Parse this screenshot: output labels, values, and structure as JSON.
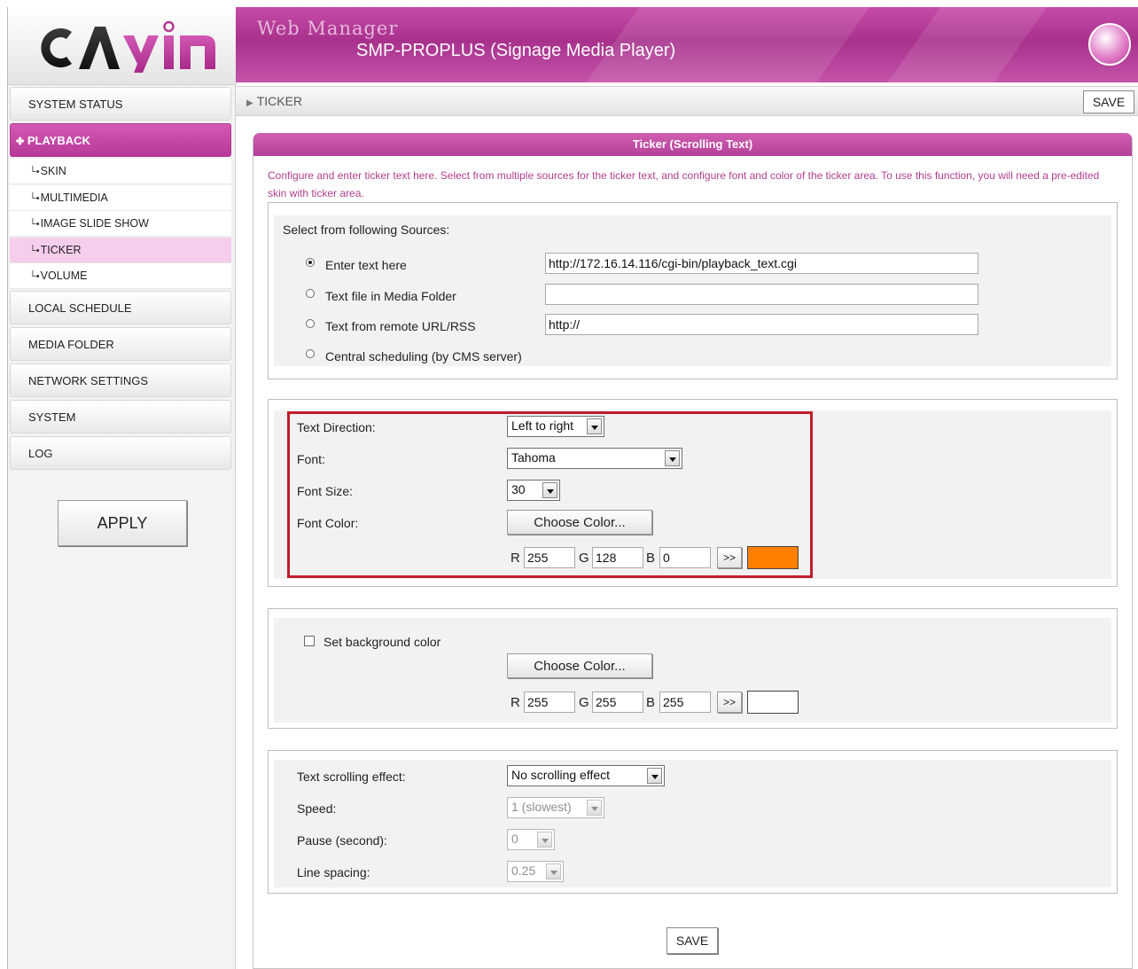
{
  "app": {
    "title": "Web Manager",
    "subtitle": "SMP-PROPLUS (Signage Media Player)",
    "logo_text": "CAYIN",
    "accent_color": "#b73898"
  },
  "sidebar": {
    "items": [
      {
        "label": "SYSTEM STATUS"
      },
      {
        "label": "PLAYBACK"
      },
      {
        "label": "LOCAL SCHEDULE"
      },
      {
        "label": "MEDIA FOLDER"
      },
      {
        "label": "NETWORK SETTINGS"
      },
      {
        "label": "SYSTEM"
      },
      {
        "label": "LOG"
      }
    ],
    "playback_icon": "✤",
    "sub_items": [
      {
        "label": "SKIN"
      },
      {
        "label": "MULTIMEDIA"
      },
      {
        "label": "IMAGE SLIDE SHOW"
      },
      {
        "label": "TICKER"
      },
      {
        "label": "VOLUME"
      }
    ],
    "sub_mark": "└•",
    "apply_label": "APPLY"
  },
  "breadcrumb": {
    "arrow": "▶",
    "label": "TICKER",
    "save_label": "SAVE"
  },
  "panel": {
    "title": "Ticker (Scrolling Text)",
    "description": "Configure and enter ticker text here. Select from multiple sources for the ticker text, and configure font and color of the ticker area. To use this function, you will need a pre-edited skin with ticker area."
  },
  "sources": {
    "heading": "Select from following Sources:",
    "options": [
      {
        "label": "Enter text here",
        "selected": true,
        "value": "http://172.16.14.116/cgi-bin/playback_text.cgi"
      },
      {
        "label": "Text file in Media Folder",
        "selected": false,
        "value": ""
      },
      {
        "label": "Text from remote URL/RSS",
        "selected": false,
        "value": "http://"
      },
      {
        "label": "Central scheduling (by CMS server)",
        "selected": false
      }
    ]
  },
  "font": {
    "direction_label": "Text Direction:",
    "direction_value": "Left to right",
    "font_label": "Font:",
    "font_value": "Tahoma",
    "size_label": "Font Size:",
    "size_value": "30",
    "color_label": "Font Color:",
    "choose_color_label": "Choose Color...",
    "r_label": "R",
    "g_label": "G",
    "b_label": "B",
    "r": "255",
    "g": "128",
    "b": "0",
    "apply_label": ">>",
    "swatch_color": "#ff8000"
  },
  "background": {
    "checkbox_label": "Set background color",
    "checked": false,
    "choose_color_label": "Choose Color...",
    "r_label": "R",
    "g_label": "G",
    "b_label": "B",
    "r": "255",
    "g": "255",
    "b": "255",
    "apply_label": ">>",
    "swatch_color": "#ffffff"
  },
  "scrolling": {
    "effect_label": "Text scrolling effect:",
    "effect_value": "No scrolling effect",
    "speed_label": "Speed:",
    "speed_value": "1 (slowest)",
    "pause_label": "Pause (second):",
    "pause_value": "0",
    "spacing_label": "Line spacing:",
    "spacing_value": "0.25"
  },
  "footer": {
    "save_label": "SAVE"
  }
}
